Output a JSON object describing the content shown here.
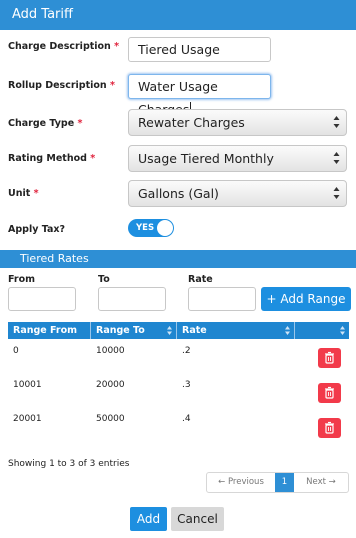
{
  "dialog": {
    "title": "Add Tariff"
  },
  "fields": {
    "charge_description": {
      "label": "Charge Description",
      "required": "*",
      "value": "Tiered Usage"
    },
    "rollup_description": {
      "label": "Rollup Description",
      "required": "*",
      "value": "Water Usage Charges"
    },
    "charge_type": {
      "label": "Charge Type",
      "required": "*",
      "value": "Rewater Charges"
    },
    "rating_method": {
      "label": "Rating Method",
      "required": "*",
      "value": "Usage Tiered Monthly"
    },
    "unit": {
      "label": "Unit",
      "required": "*",
      "value": "Gallons (Gal)"
    },
    "apply_tax": {
      "label": "Apply Tax?",
      "value": "YES"
    }
  },
  "tiered_rates": {
    "title": "Tiered Rates",
    "from_label": "From",
    "to_label": "To",
    "rate_label": "Rate",
    "add_range_label": "+ Add Range"
  },
  "table": {
    "headers": [
      "Range From",
      "Range To",
      "Rate",
      ""
    ],
    "rows": [
      {
        "from": "0",
        "to": "10000",
        "rate": ".2"
      },
      {
        "from": "10001",
        "to": "20000",
        "rate": ".3"
      },
      {
        "from": "20001",
        "to": "50000",
        "rate": ".4"
      }
    ],
    "info": "Showing 1 to 3 of 3 entries"
  },
  "pagination": {
    "previous": "← Previous",
    "page": "1",
    "next": "Next →"
  },
  "footer": {
    "add_label": "Add",
    "cancel_label": "Cancel"
  },
  "colors": {
    "accent": "#2e8fd5",
    "danger": "#f23a4a",
    "required": "#e0233d"
  }
}
